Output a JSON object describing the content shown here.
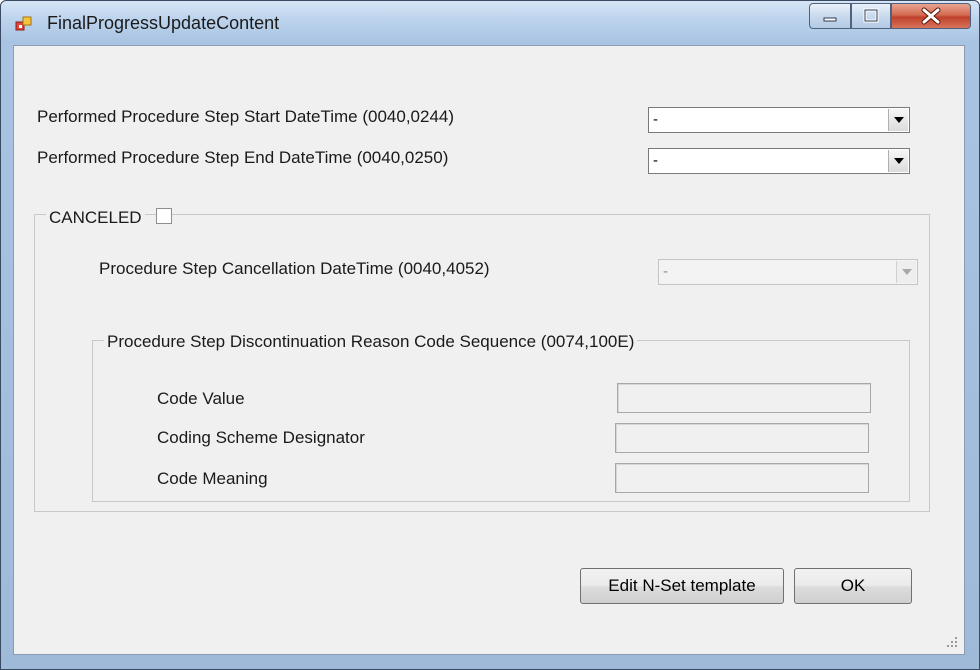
{
  "window": {
    "title": "FinalProgressUpdateContent"
  },
  "fields": {
    "start_label": "Performed Procedure Step Start DateTime (0040,0244)",
    "start_value": "-",
    "end_label": "Performed Procedure Step End DateTime (0040,0250)",
    "end_value": "-"
  },
  "canceled": {
    "label": "CANCELED",
    "checked": false,
    "cancellation_label": "Procedure Step Cancellation DateTime  (0040,4052)",
    "cancellation_value": "-",
    "reason_group": {
      "title": "Procedure Step Discontinuation Reason Code Sequence (0074,100E)",
      "code_value_label": "Code Value",
      "code_value": "",
      "coding_scheme_label": "Coding Scheme Designator",
      "coding_scheme_value": "",
      "code_meaning_label": "Code Meaning",
      "code_meaning_value": ""
    }
  },
  "buttons": {
    "edit_template": "Edit N-Set template",
    "ok": "OK"
  },
  "icons": [
    "app-icon",
    "minimize-icon",
    "maximize-icon",
    "close-icon",
    "dropdown-arrow-icon",
    "resize-grip-icon"
  ]
}
